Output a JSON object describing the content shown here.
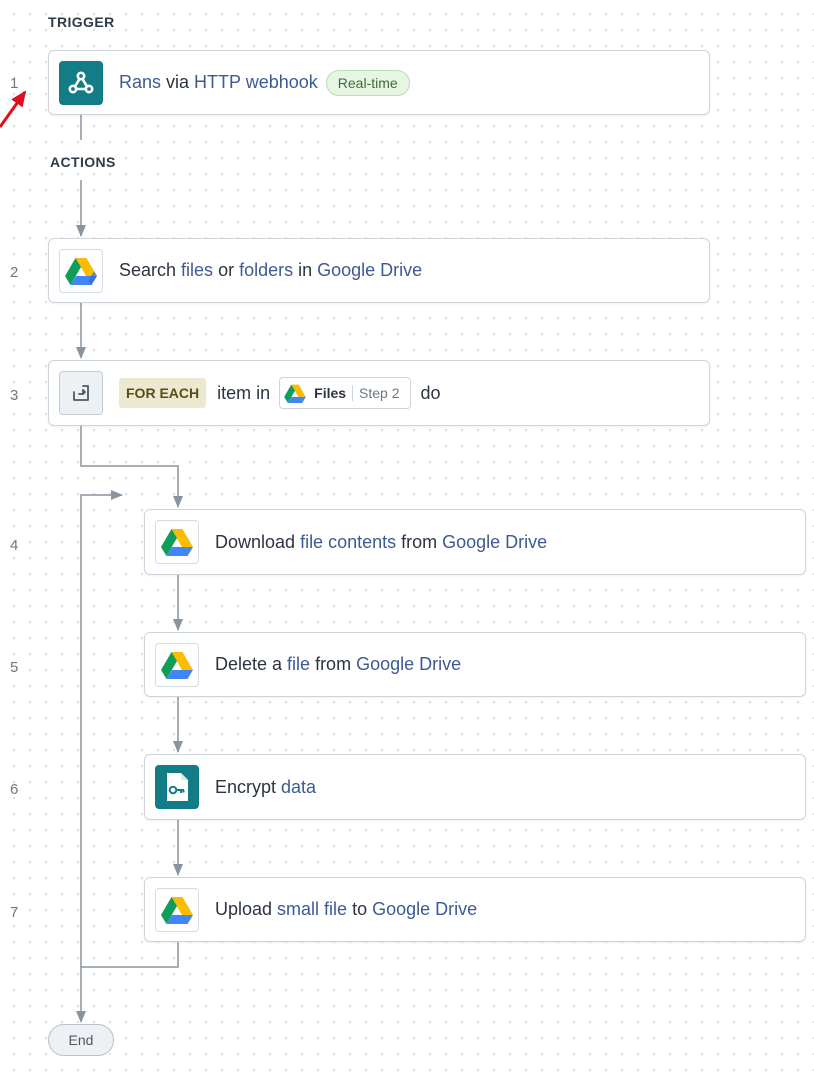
{
  "sections": {
    "trigger": "TRIGGER",
    "actions": "ACTIONS"
  },
  "steps": [
    {
      "number": "1",
      "icon": "webhook-icon",
      "parts": [
        "Rans",
        " via ",
        "HTTP webhook"
      ],
      "badge": "Real-time"
    },
    {
      "number": "2",
      "icon": "google-drive-icon",
      "parts": [
        "Search ",
        "files",
        " or ",
        "folders",
        " in ",
        "Google Drive"
      ]
    },
    {
      "number": "3",
      "icon": "repeat-icon",
      "keyword": "FOR EACH",
      "pre": "item in",
      "datapill": {
        "label": "Files",
        "step": "Step 2",
        "icon": "google-drive-icon"
      },
      "post": "do"
    },
    {
      "number": "4",
      "icon": "google-drive-icon",
      "parts": [
        "Download ",
        "file contents",
        " from ",
        "Google Drive"
      ]
    },
    {
      "number": "5",
      "icon": "google-drive-icon",
      "parts": [
        "Delete a ",
        "file",
        " from ",
        "Google Drive"
      ]
    },
    {
      "number": "6",
      "icon": "encrypt-file-icon",
      "parts": [
        "Encrypt ",
        "data"
      ]
    },
    {
      "number": "7",
      "icon": "google-drive-icon",
      "parts": [
        "Upload ",
        "small file",
        " to ",
        "Google Drive"
      ]
    }
  ],
  "end_label": "End",
  "colors": {
    "link": "#3e5a94",
    "teal": "#127c87",
    "badge_bg": "#e7f5e3",
    "foreach_bg": "#ede8d0",
    "connector": "#8a949f",
    "annotation_arrow": "#e0101a"
  }
}
